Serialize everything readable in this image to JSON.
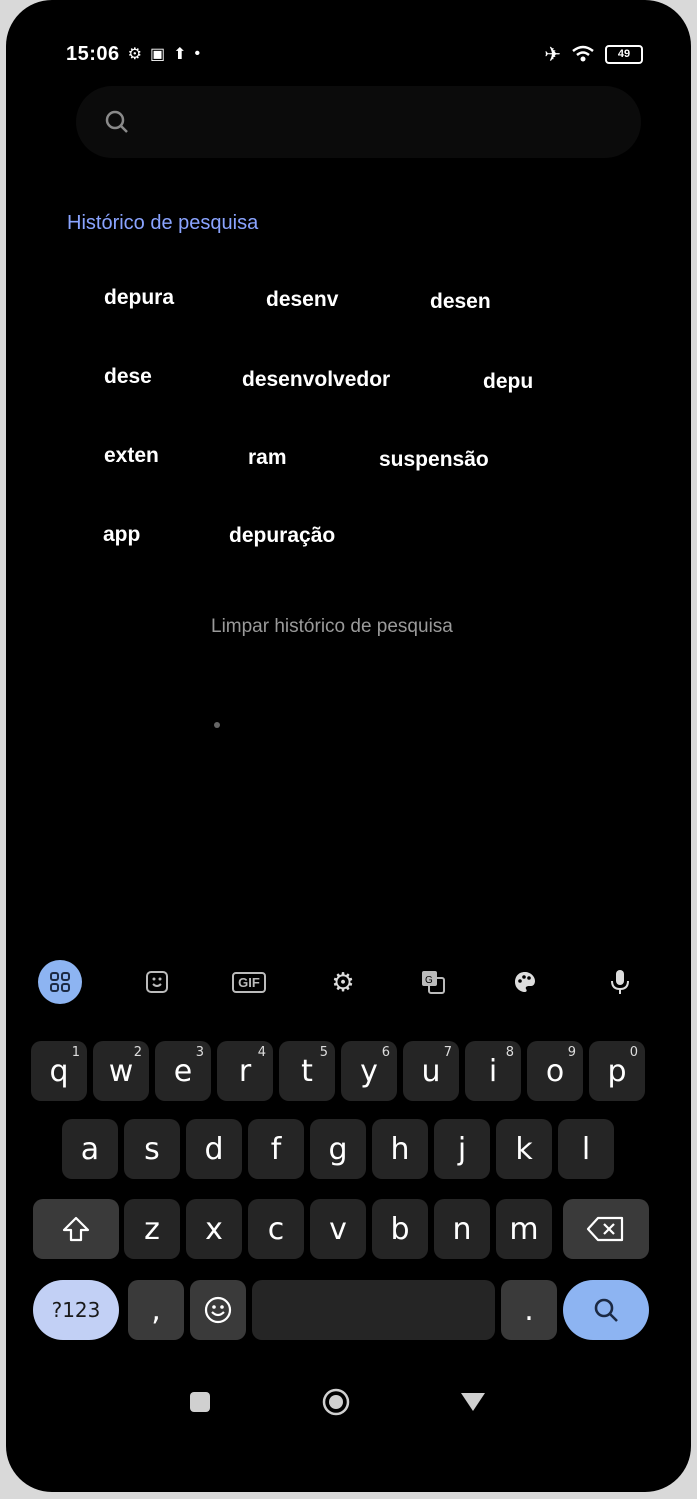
{
  "status_bar": {
    "time": "15:06",
    "battery": "49",
    "left_icons": [
      "settings-status-icon",
      "notification-app-icon",
      "upload-status-icon",
      "dot-icon"
    ],
    "right_icons": [
      "airplane-icon",
      "wifi-icon",
      "battery-icon"
    ]
  },
  "search": {
    "placeholder": "",
    "icon": "search-icon"
  },
  "history": {
    "title": "Histórico de pesquisa",
    "items": [
      "depura",
      "desenv",
      "desen",
      "dese",
      "desenvolvedor",
      "depu",
      "exten",
      "ram",
      "suspensão",
      "app",
      "depuração"
    ],
    "clear_label": "Limpar histórico de pesquisa"
  },
  "keyboard": {
    "toolbar": [
      "apps-grid-icon",
      "sticker-icon",
      "gif-icon",
      "settings-icon",
      "translate-icon",
      "palette-icon",
      "microphone-icon"
    ],
    "gif_label": "GIF",
    "row1": [
      {
        "key": "q",
        "hint": "1"
      },
      {
        "key": "w",
        "hint": "2"
      },
      {
        "key": "e",
        "hint": "3"
      },
      {
        "key": "r",
        "hint": "4"
      },
      {
        "key": "t",
        "hint": "5"
      },
      {
        "key": "y",
        "hint": "6"
      },
      {
        "key": "u",
        "hint": "7"
      },
      {
        "key": "i",
        "hint": "8"
      },
      {
        "key": "o",
        "hint": "9"
      },
      {
        "key": "p",
        "hint": "0"
      }
    ],
    "row2": [
      "a",
      "s",
      "d",
      "f",
      "g",
      "h",
      "j",
      "k",
      "l"
    ],
    "row3": [
      "z",
      "x",
      "c",
      "v",
      "b",
      "n",
      "m"
    ],
    "symbols_label": "?123",
    "comma": ",",
    "period": "."
  },
  "nav_bar": [
    "recents-icon",
    "home-icon",
    "back-icon"
  ],
  "colors": {
    "accent": "#8db4f2",
    "history_title": "#8aa4ff",
    "background": "#000000"
  }
}
